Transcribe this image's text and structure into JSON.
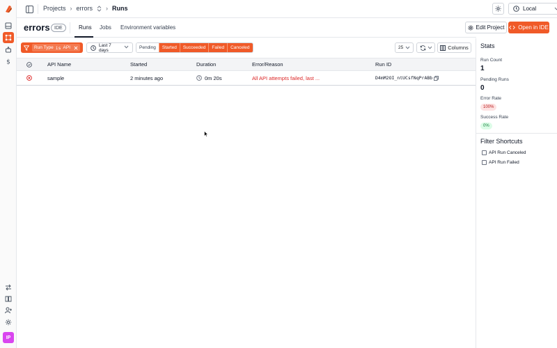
{
  "rail": {
    "logo": "logo-icon",
    "items_top": [
      "window-icon",
      "runs-icon",
      "robot-icon",
      "dollar-icon"
    ],
    "active_index": 1,
    "items_bottom": [
      "swap-icon",
      "book-icon",
      "user-plus-icon",
      "settings-icon"
    ],
    "avatar": "IP"
  },
  "topbar": {
    "breadcrumbs": [
      "Projects",
      "errors",
      "Runs"
    ],
    "environment": "Local"
  },
  "project": {
    "name": "errors",
    "badge": "IDE",
    "tabs": [
      "Runs",
      "Jobs",
      "Environment variables"
    ],
    "active_tab": 0,
    "edit_label": "Edit Project",
    "open_label": "Open in IDE"
  },
  "filters": {
    "chip_key": "Run Type",
    "chip_op": "is",
    "chip_value": "API",
    "date_range": "Last 7 days",
    "statuses": [
      {
        "label": "Pending",
        "active": false
      },
      {
        "label": "Started",
        "active": true
      },
      {
        "label": "Succeeded",
        "active": true
      },
      {
        "label": "Failed",
        "active": true
      },
      {
        "label": "Canceled",
        "active": true
      }
    ],
    "page_size": "25",
    "columns_label": "Columns"
  },
  "table": {
    "headers": [
      "API Name",
      "Started",
      "Duration",
      "Error/Reason",
      "Run ID"
    ],
    "rows": [
      {
        "status": "failed",
        "api_name": "sample",
        "started": "2 minutes ago",
        "duration": "0m 20s",
        "error": "All API attempts failed, last ...",
        "run_id": "D4mM2OI_ntUCsfNqPrABb"
      }
    ]
  },
  "stats": {
    "title": "Stats",
    "run_count_label": "Run Count",
    "run_count": "1",
    "pending_label": "Pending Runs",
    "pending": "0",
    "error_rate_label": "Error Rate",
    "error_rate": "100%",
    "success_rate_label": "Success Rate",
    "success_rate": "0%"
  },
  "shortcuts": {
    "title": "Filter Shortcuts",
    "items": [
      "API Run Canceled",
      "API Run Failed"
    ]
  },
  "colors": {
    "accent": "#f05a28",
    "error": "#dc2626"
  }
}
